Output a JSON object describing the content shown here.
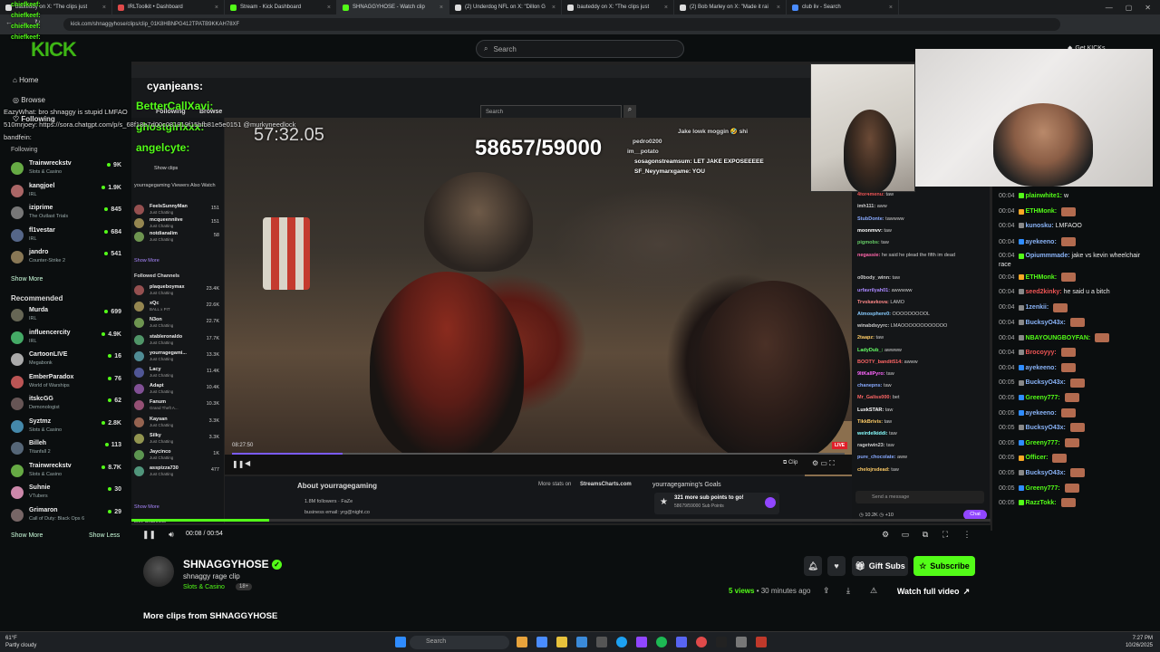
{
  "browser": {
    "tabs": [
      {
        "label": "bauteddy on X: \"The clips just",
        "color": "#ddd"
      },
      {
        "label": "IRLToolkit • Dashboard",
        "color": "#e04a4a"
      },
      {
        "label": "Stream - Kick Dashboard",
        "color": "#53fc18"
      },
      {
        "label": "SHNAGGYHOSE - Watch clip",
        "color": "#53fc18"
      },
      {
        "label": "(2) Underdog NFL on X: \"Dillon G",
        "color": "#ddd"
      },
      {
        "label": "bauteddy on X: \"The clips just",
        "color": "#ddd"
      },
      {
        "label": "(2) Bob Marley on X: \"Made it rai",
        "color": "#ddd"
      },
      {
        "label": "club liv - Search",
        "color": "#4a8cff"
      }
    ],
    "url": "kick.com/shnaggyhose/clips/clip_01K8HBNPG412TPATB9KKAH78XF"
  },
  "kick": {
    "logo": "KICK",
    "search_placeholder": "Search",
    "get_kicks": "Get KICKs"
  },
  "overlay_names": [
    {
      "t": "chiefkeef:",
      "c": "#53fc18"
    },
    {
      "t": "chiefkeef:",
      "c": "#53fc18"
    },
    {
      "t": "chiefkeef:",
      "c": "#53fc18"
    },
    {
      "t": "chiefkeef:",
      "c": "#53fc18"
    }
  ],
  "sidebar": {
    "home": "Home",
    "browse": "Browse",
    "following": "Following",
    "following_header": "Following",
    "follow_channels": [
      {
        "name": "Trainwreckstv",
        "game": "Slots & Casino",
        "viewers": "9K",
        "color": "#6a4"
      },
      {
        "name": "kangjoel",
        "game": "IRL",
        "viewers": "1.9K",
        "color": "#a66"
      },
      {
        "name": "iziprime",
        "game": "The Outlast Trials",
        "viewers": "845",
        "color": "#777"
      },
      {
        "name": "fl1vestar",
        "game": "IRL",
        "viewers": "684",
        "color": "#568"
      },
      {
        "name": "jandro",
        "game": "Counter-Strike 2",
        "viewers": "541",
        "color": "#875"
      }
    ],
    "show_more": "Show More",
    "recommended": "Recommended",
    "rec_channels": [
      {
        "name": "Murda",
        "game": "IRL",
        "viewers": "699",
        "color": "#665"
      },
      {
        "name": "influencercity",
        "game": "IRL",
        "viewers": "4.9K",
        "color": "#4a6"
      },
      {
        "name": "CartoonLIVE",
        "game": "Megabonk",
        "viewers": "16",
        "color": "#aaa"
      },
      {
        "name": "EmberParadox",
        "game": "World of Warships",
        "viewers": "76",
        "color": "#b55"
      },
      {
        "name": "itskcGG",
        "game": "Demonologist",
        "viewers": "62",
        "color": "#655"
      },
      {
        "name": "Syztmz",
        "game": "Slots & Casino",
        "viewers": "2.8K",
        "color": "#48a"
      },
      {
        "name": "Billeh",
        "game": "Titanfall 2",
        "viewers": "113",
        "color": "#567"
      },
      {
        "name": "Trainwreckstv",
        "game": "Slots & Casino",
        "viewers": "8.7K",
        "color": "#6a4"
      },
      {
        "name": "Suhnie",
        "game": "VTubers",
        "viewers": "30",
        "color": "#c8a"
      },
      {
        "name": "Grimaron",
        "game": "Call of Duty: Black Ops 6",
        "viewers": "29",
        "color": "#766"
      }
    ],
    "show_more_2": "Show More",
    "show_less": "Show Less"
  },
  "left_chat_overlay": [
    {
      "t": "EazyWhat: bro shnaggy is stupid LMFAO",
      "c": "#ddd"
    },
    {
      "t": "510mrjoey: https://sora.chatgpt.com/p/s_68f18e7d00c081919f15bfb81e5e0151 @murkyneedlock",
      "c": "#ddd"
    },
    {
      "t": "bandfein:",
      "c": "#ddd"
    }
  ],
  "inner_stream": {
    "search": "Search",
    "following": "Following",
    "browse": "Browse",
    "show_clips": "Show clips",
    "viewers_also_watch": "yourragegaming Viewers Also Watch",
    "also": [
      {
        "n": "FeelsSunnyMan",
        "s": "Just Chatting",
        "v": "151"
      },
      {
        "n": "mcqueenniive",
        "s": "Just Chatting",
        "v": "151"
      },
      {
        "n": "notdianalim",
        "s": "Just Chatting",
        "v": "58"
      }
    ],
    "show_more": "Show More",
    "followed_channels": "Followed Channels",
    "followed": [
      {
        "n": "plaqueboymax",
        "s": "Just Chatting",
        "v": "23.4K"
      },
      {
        "n": "xQc",
        "s": "BALL x PIT",
        "v": "22.6K"
      },
      {
        "n": "N3on",
        "s": "Just Chatting",
        "v": "22.7K"
      },
      {
        "n": "stableronaldo",
        "s": "Just Chatting",
        "v": "17.7K"
      },
      {
        "n": "yourragegami...",
        "s": "Just Chatting",
        "v": "13.3K"
      },
      {
        "n": "Lacy",
        "s": "Just Chatting",
        "v": "11.4K"
      },
      {
        "n": "Adapt",
        "s": "Just Chatting",
        "v": "10.4K"
      },
      {
        "n": "Fanum",
        "s": "Grand Theft A...",
        "v": "10.3K"
      },
      {
        "n": "Kaysan",
        "s": "Just Chatting",
        "v": "3.3K"
      },
      {
        "n": "Silky",
        "s": "Just Chatting",
        "v": "3.3K"
      },
      {
        "n": "Jaycinco",
        "s": "Just Chatting",
        "v": "1K"
      },
      {
        "n": "asspizza730",
        "s": "Just Chatting",
        "v": "477"
      }
    ],
    "show_more_2": "Show More",
    "live_channels": "Live Channels",
    "sub_count": "58657/59000",
    "timer": "57:32.05",
    "timestamp": "08:27:50",
    "live": "LIVE",
    "about": "About yourragegaming",
    "followers": "1.8M followers · FaZe",
    "email": "business email: yrg@night.co",
    "more_stats": "More stats on",
    "streamscharts": "StreamsCharts.com",
    "goals": "yourragegaming's Goals",
    "goal_line1": "321 more sub points to go!",
    "goal_line2": "58679/59000 Sub Points",
    "clip": "Clip",
    "chat_placeholder": "Send a message",
    "chat_button": "Chat",
    "viewer_count": "10.2K",
    "points": "+10"
  },
  "stream_overlay_chat": [
    {
      "t": "sosagonstreamsum: LET JAKE EXPOSEEEEE",
      "c": "#fff"
    },
    {
      "t": "SF_Neyymarxgame: YOU",
      "c": "#fff"
    },
    {
      "t": "Jake lowk moggin 🤣 shi",
      "c": "#ddd"
    },
    {
      "t": "pedro0200",
      "c": "#ddd"
    },
    {
      "t": "im__potato",
      "c": "#ddd"
    }
  ],
  "overlay_left_names": [
    {
      "t": "cyanjeans:",
      "c": "#fff"
    },
    {
      "t": "BetterCallXavi:",
      "c": "#53fc18"
    },
    {
      "t": "ghostgirlxxx:",
      "c": "#53fc18"
    },
    {
      "t": "angelcyte:",
      "c": "#53fc18"
    }
  ],
  "inner_chat": [
    {
      "u": "4for4menu:",
      "m": "taw",
      "c": "#e55"
    },
    {
      "u": "imh111:",
      "m": "aww",
      "c": "#ccc"
    },
    {
      "u": "StubDonte:",
      "m": "tawwww",
      "c": "#8af"
    },
    {
      "u": "moonmvv:",
      "m": "taw",
      "c": "#fff"
    },
    {
      "u": "pigmobs:",
      "m": "taw",
      "c": "#6c6"
    },
    {
      "u": "negassie:",
      "m": "he said he plead the fifth im dead",
      "c": "#f6a"
    },
    {
      "u": "o0body_winn:",
      "m": "taw",
      "c": "#ccc"
    },
    {
      "u": "urfavrilyah01:",
      "m": "awwwww",
      "c": "#a8f"
    },
    {
      "u": "Trvskavkova:",
      "m": "LAMO",
      "c": "#f88"
    },
    {
      "u": "Atmosphere0:",
      "m": "OOOOOOOOOL",
      "c": "#8cf"
    },
    {
      "u": "winabdsyyrc:",
      "m": "LMAOOOOOOOOOOOO",
      "c": "#ccc"
    },
    {
      "u": "2taapz:",
      "m": "taw",
      "c": "#fc6"
    },
    {
      "u": "LadyDub_:",
      "m": "awwww",
      "c": "#6f6"
    },
    {
      "u": "BOOTY_bandit514:",
      "m": "awww",
      "c": "#f66"
    },
    {
      "u": "9ItKallPyro:",
      "m": "taw",
      "c": "#f6f"
    },
    {
      "u": "chanepns:",
      "m": "taw",
      "c": "#8af"
    },
    {
      "u": "Mr_Galiss000:",
      "m": "bet",
      "c": "#f66"
    },
    {
      "u": "LuxkSTAR:",
      "m": "taw",
      "c": "#fff"
    },
    {
      "u": "TikkBrivis:",
      "m": "taw",
      "c": "#fc6"
    },
    {
      "u": "weirdelkiddi:",
      "m": "taw",
      "c": "#8ff"
    },
    {
      "u": "ragetwin23:",
      "m": "taw",
      "c": "#ccc"
    },
    {
      "u": "pure_chocolate:",
      "m": "aww",
      "c": "#8af"
    },
    {
      "u": "chelojrsdead:",
      "m": "taw",
      "c": "#fc6"
    }
  ],
  "right_chat": [
    {
      "tm": "00:04",
      "u": "plainwhite1:",
      "m": "w",
      "c": "#53fc18",
      "b": "#53fc18",
      "e": false
    },
    {
      "tm": "00:04",
      "u": "ETHMonk:",
      "m": "",
      "c": "#53fc18",
      "b": "#f9a825",
      "e": true
    },
    {
      "tm": "00:04",
      "u": "kunosku:",
      "m": "LMFAOO",
      "c": "#8ab4f8",
      "b": "#888",
      "e": false
    },
    {
      "tm": "00:04",
      "u": "ayekeeno:",
      "m": "",
      "c": "#8ab4f8",
      "b": "#2f8cff",
      "e": true
    },
    {
      "tm": "00:04",
      "u": "Opiummmade:",
      "m": "jake vs kevin wheelchair race",
      "c": "#8ab4f8",
      "b": "#53fc18",
      "e": false
    },
    {
      "tm": "00:04",
      "u": "ETHMonk:",
      "m": "",
      "c": "#53fc18",
      "b": "#f9a825",
      "e": true
    },
    {
      "tm": "00:04",
      "u": "seed2kinky:",
      "m": "he said u a bitch",
      "c": "#e55",
      "b": "#888",
      "e": false
    },
    {
      "tm": "00:04",
      "u": "1zenkii:",
      "m": "",
      "c": "#8ab4f8",
      "b": "#888",
      "e": true
    },
    {
      "tm": "00:04",
      "u": "BucksyO43x:",
      "m": "",
      "c": "#8ab4f8",
      "b": "#888",
      "e": true
    },
    {
      "tm": "00:04",
      "u": "NBAYOUNGBOYFAN:",
      "m": "",
      "c": "#53fc18",
      "b": "#888",
      "e": true
    },
    {
      "tm": "00:04",
      "u": "Brocoyyy:",
      "m": "",
      "c": "#e55",
      "b": "#888",
      "e": true
    },
    {
      "tm": "00:04",
      "u": "ayekeeno:",
      "m": "",
      "c": "#8ab4f8",
      "b": "#2f8cff",
      "e": true
    },
    {
      "tm": "00:05",
      "u": "BucksyO43x:",
      "m": "",
      "c": "#8ab4f8",
      "b": "#888",
      "e": true
    },
    {
      "tm": "00:05",
      "u": "Greeny777:",
      "m": "",
      "c": "#53fc18",
      "b": "#2f8cff",
      "e": true
    },
    {
      "tm": "00:05",
      "u": "ayekeeno:",
      "m": "",
      "c": "#8ab4f8",
      "b": "#2f8cff",
      "e": true
    },
    {
      "tm": "00:05",
      "u": "BucksyO43x:",
      "m": "",
      "c": "#8ab4f8",
      "b": "#888",
      "e": true
    },
    {
      "tm": "00:05",
      "u": "Greeny777:",
      "m": "",
      "c": "#53fc18",
      "b": "#2f8cff",
      "e": true
    },
    {
      "tm": "00:05",
      "u": "Officer:",
      "m": "",
      "c": "#53fc18",
      "b": "#f9a825",
      "e": true
    },
    {
      "tm": "00:05",
      "u": "BucksyO43x:",
      "m": "",
      "c": "#8ab4f8",
      "b": "#888",
      "e": true
    },
    {
      "tm": "00:05",
      "u": "Greeny777:",
      "m": "",
      "c": "#53fc18",
      "b": "#2f8cff",
      "e": true
    },
    {
      "tm": "00:05",
      "u": "RazzTokk:",
      "m": "",
      "c": "#53fc18",
      "b": "#53fc18",
      "e": true
    }
  ],
  "player": {
    "time": "00:08 / 00:54",
    "progress": 0.16
  },
  "channel": {
    "name": "SHNAGGYHOSE",
    "clip_title": "shnaggy rage clip",
    "category": "Slots & Casino",
    "age": "18+",
    "views": "5 views",
    "ago": "• 30 minutes ago",
    "gift_subs": "Gift Subs",
    "subscribe": "Subscribe",
    "watch_full": "Watch full video",
    "more_clips": "More clips from SHNAGGYHOSE"
  },
  "taskbar": {
    "weather_temp": "61°F",
    "weather_desc": "Partly cloudy",
    "search": "Search",
    "time": "7:27 PM",
    "date": "10/26/2025"
  },
  "colors": {
    "kick_green": "#53fc18",
    "bg": "#0b0e0f",
    "twitch_purple": "#9146ff"
  }
}
